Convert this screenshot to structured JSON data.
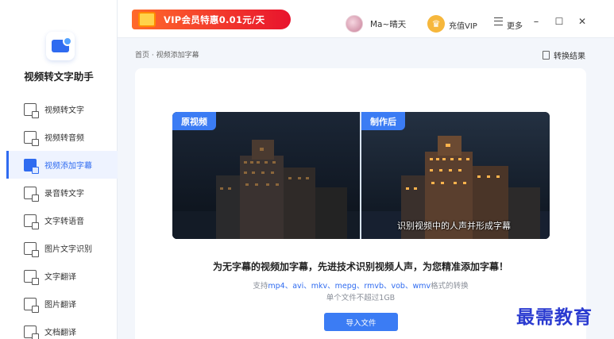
{
  "app": {
    "name": "视频转文字助手"
  },
  "sidebar": {
    "items": [
      {
        "label": "视频转文字",
        "active": false,
        "icon": "video-to-text-icon"
      },
      {
        "label": "视频转音频",
        "active": false,
        "icon": "video-to-audio-icon"
      },
      {
        "label": "视频添加字幕",
        "active": true,
        "icon": "video-subtitle-icon"
      },
      {
        "label": "录音转文字",
        "active": false,
        "icon": "recording-to-text-icon"
      },
      {
        "label": "文字转语音",
        "active": false,
        "icon": "text-to-speech-icon"
      },
      {
        "label": "图片文字识别",
        "active": false,
        "icon": "image-ocr-icon"
      },
      {
        "label": "文字翻译",
        "active": false,
        "icon": "text-translate-icon"
      },
      {
        "label": "图片翻译",
        "active": false,
        "icon": "image-translate-icon"
      },
      {
        "label": "文档翻译",
        "active": false,
        "icon": "document-translate-icon"
      }
    ]
  },
  "topbar": {
    "vip_banner": "VIP会员特惠0.01元/天",
    "user_name": "Ma~晴天",
    "vip_label": "充值VIP",
    "more_label": "更多",
    "minimize": "–",
    "maximize": "☐",
    "close": "✕"
  },
  "content": {
    "breadcrumb": "首页 · 视频添加字幕",
    "result_link": "转换结果",
    "tag_original": "原视频",
    "tag_result": "制作后",
    "subtitle_sample": "识别视频中的人声并形成字幕",
    "headline": "为无字幕的视频加字幕，先进技术识别视频人声，为您精准添加字幕！",
    "formats_prefix": "支持",
    "formats_list": "mp4、avi、mkv、mepg、rmvb、vob、wmv",
    "formats_suffix": "格式的转换",
    "limit": "单个文件不超过1GB",
    "import_button": "导入文件"
  },
  "watermark": "最需教育",
  "colors": {
    "accent": "#3b7cf4",
    "active_nav": "#2f6bf0",
    "vip_red": "#e8132d",
    "vip_gold": "#f6b73c"
  }
}
